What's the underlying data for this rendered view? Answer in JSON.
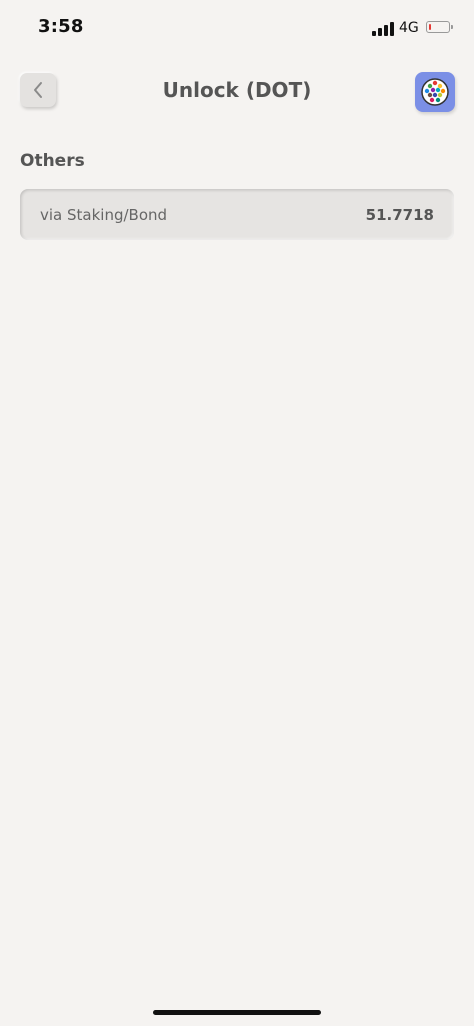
{
  "status_bar": {
    "time": "3:58",
    "network": "4G",
    "battery_level": 0.1
  },
  "header": {
    "title": "Unlock (DOT)",
    "back_icon": "chevron-left-icon",
    "avatar_icon": "identicon-icon",
    "avatar_color": "#7b8fe6"
  },
  "section": {
    "title": "Others",
    "items": [
      {
        "label": "via Staking/Bond",
        "value": "51.7718"
      }
    ]
  }
}
